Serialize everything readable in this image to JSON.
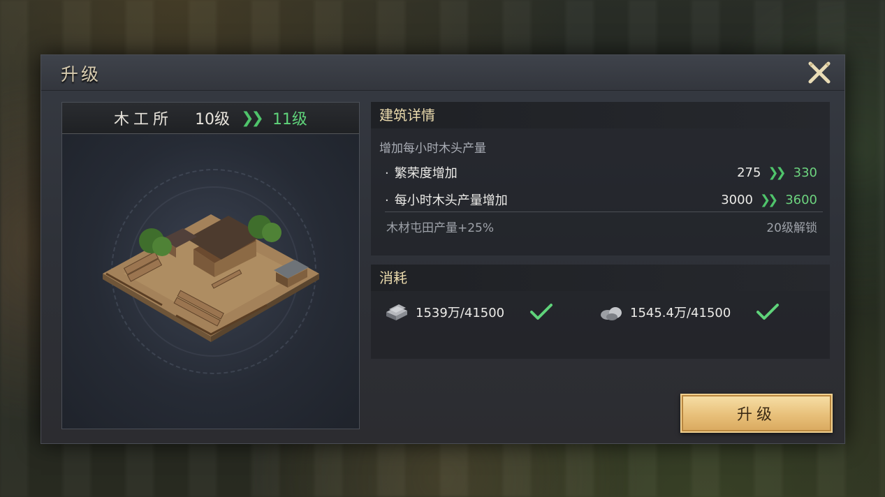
{
  "dialog": {
    "title": "升级",
    "close_icon": "close-icon"
  },
  "building": {
    "name": "木工所",
    "current_level": "10级",
    "next_level": "11级",
    "arrow": "»",
    "image": "lumber-mill-building"
  },
  "details": {
    "header": "建筑详情",
    "description": "增加每小时木头产量",
    "stats": [
      {
        "label": "繁荣度增加",
        "from": "275",
        "to": "330"
      },
      {
        "label": "每小时木头产量增加",
        "from": "3000",
        "to": "3600"
      }
    ],
    "locked_bonus": {
      "label": "木材屯田产量+25%",
      "unlock": "20级解锁"
    }
  },
  "costs": {
    "header": "消耗",
    "items": [
      {
        "icon": "iron-ingot-icon",
        "amount": "1539万/41500",
        "met": true
      },
      {
        "icon": "stone-icon",
        "amount": "1545.4万/41500",
        "met": true
      }
    ]
  },
  "actions": {
    "upgrade_label": "升级"
  },
  "colors": {
    "accent_green": "#5fd37a",
    "button_gold": "#e8c07a",
    "header_text": "#ecdcae"
  }
}
